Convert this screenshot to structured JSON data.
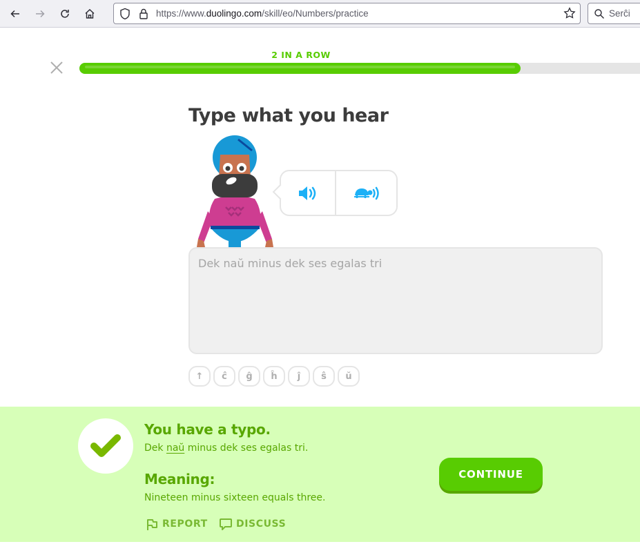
{
  "browser": {
    "url_prefix": "https://www.",
    "url_domain": "duolingo.com",
    "url_path": "/skill/eo/Numbers/practice",
    "search_placeholder": "Serĉi"
  },
  "lesson": {
    "streak_label": "2 IN A ROW",
    "progress_percent": 77,
    "title": "Type what you hear",
    "answer_value": "Dek naŭ minus dek ses egalas tri",
    "special_keys": [
      "↑",
      "ĉ",
      "ĝ",
      "ĥ",
      "ĵ",
      "ŝ",
      "ŭ"
    ]
  },
  "feedback": {
    "title": "You have a typo.",
    "correction_before": "Dek ",
    "correction_highlight": "naŭ",
    "correction_after": " minus dek ses egalas tri.",
    "meaning_label": "Meaning:",
    "meaning_text": "Nineteen minus sixteen equals three.",
    "report_label": "REPORT",
    "discuss_label": "DISCUSS",
    "continue_label": "CONTINUE"
  },
  "colors": {
    "brand_green": "#58cc02",
    "feedback_bg": "#d7ffb8",
    "feedback_text": "#58a700",
    "audio_blue": "#1cb0f6"
  }
}
